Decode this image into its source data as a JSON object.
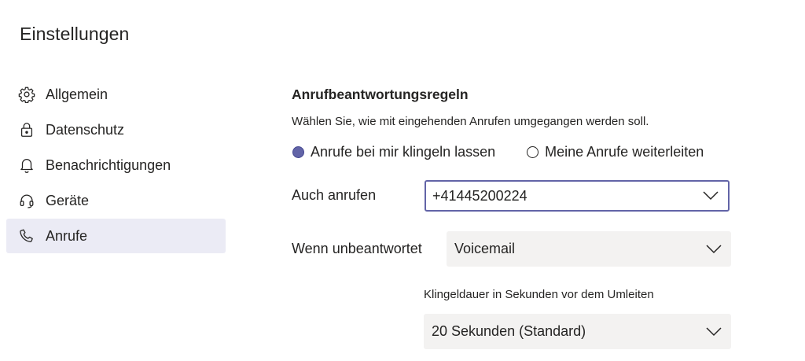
{
  "page": {
    "title": "Einstellungen"
  },
  "sidebar": {
    "items": [
      {
        "label": "Allgemein",
        "icon": "gear-icon",
        "active": false
      },
      {
        "label": "Datenschutz",
        "icon": "lock-icon",
        "active": false
      },
      {
        "label": "Benachrichtigungen",
        "icon": "bell-icon",
        "active": false
      },
      {
        "label": "Geräte",
        "icon": "headset-icon",
        "active": false
      },
      {
        "label": "Anrufe",
        "icon": "phone-icon",
        "active": true
      }
    ]
  },
  "calls": {
    "section_title": "Anrufbeantwortungsregeln",
    "description": "Wählen Sie, wie mit eingehenden Anrufen umgegangen werden soll.",
    "radio_options": [
      {
        "label": "Anrufe bei mir klingeln lassen",
        "checked": true
      },
      {
        "label": "Meine Anrufe weiterleiten",
        "checked": false
      }
    ],
    "also_call": {
      "label": "Auch anrufen",
      "value": "+41445200224"
    },
    "unanswered": {
      "label": "Wenn unbeantwortet",
      "value": "Voicemail"
    },
    "ring_duration": {
      "label": "Klingeldauer in Sekunden vor dem Umleiten",
      "value": "20 Sekunden (Standard)"
    }
  },
  "colors": {
    "accent": "#6264a7",
    "active_nav_bg": "#ebebf5",
    "select_bg": "#f3f2f1",
    "text": "#252423"
  }
}
